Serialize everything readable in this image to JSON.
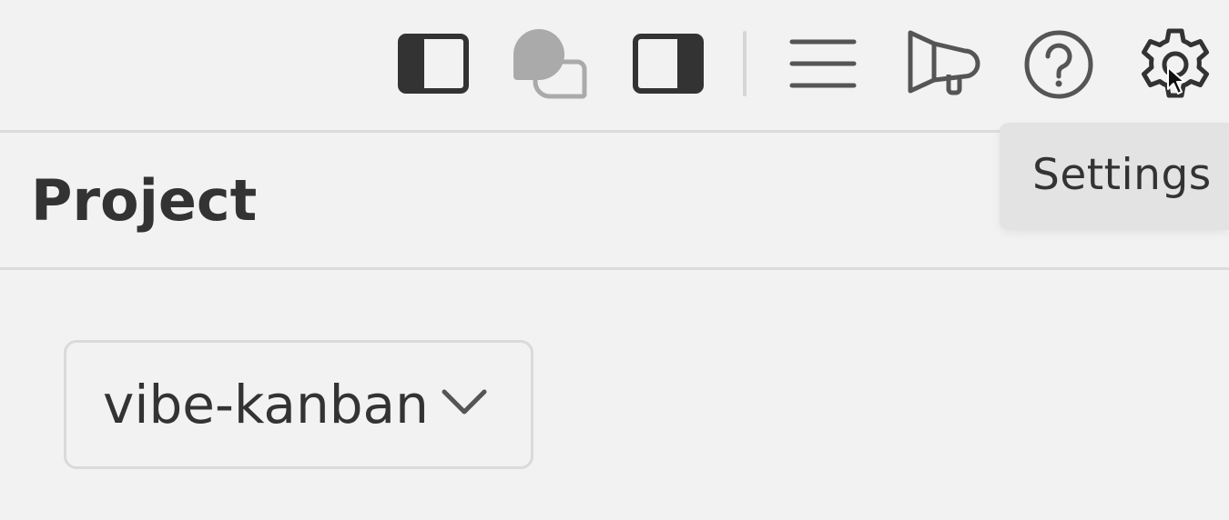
{
  "toolbar": {
    "icons": [
      {
        "name": "left-panel-toggle-icon"
      },
      {
        "name": "chat-icon"
      },
      {
        "name": "right-panel-toggle-icon"
      },
      {
        "name": "menu-icon"
      },
      {
        "name": "megaphone-icon"
      },
      {
        "name": "help-icon"
      },
      {
        "name": "gear-icon"
      }
    ],
    "tooltip": "Settings"
  },
  "section": {
    "title": "Project"
  },
  "project_select": {
    "value": "vibe-kanban"
  }
}
